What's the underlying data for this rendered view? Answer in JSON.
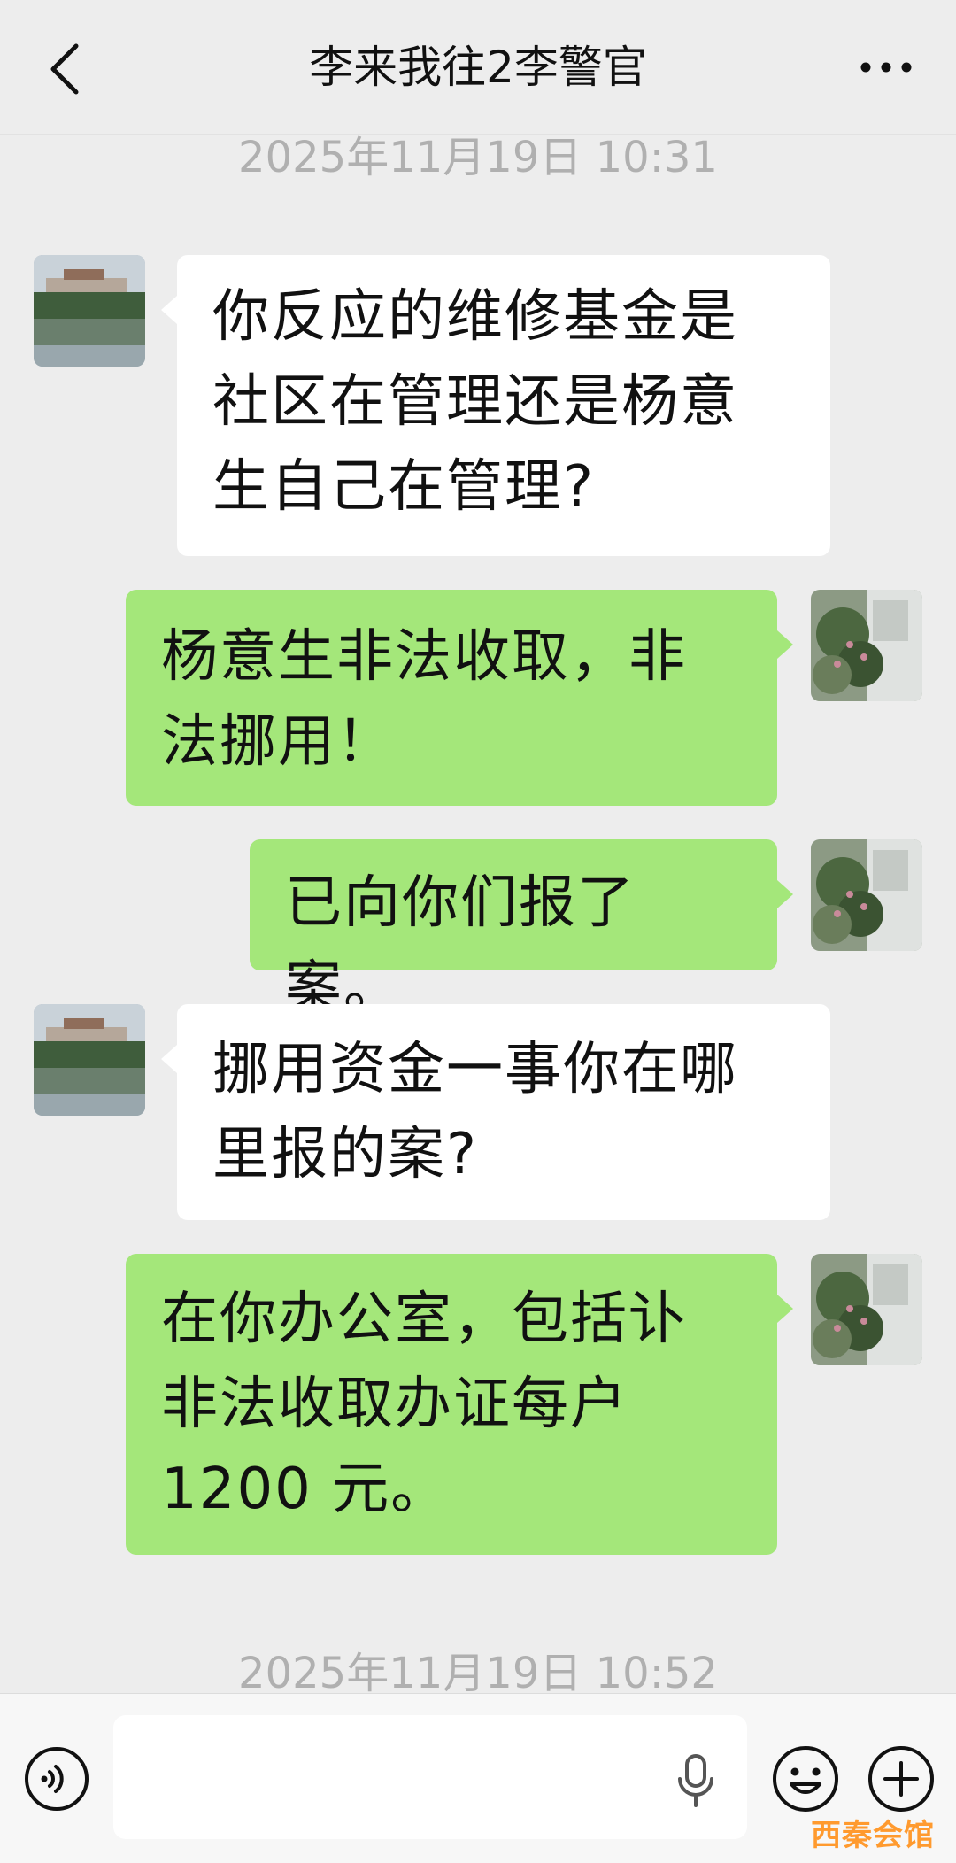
{
  "header": {
    "title": "李来我往2李警官",
    "back_icon": "chevron-left-icon",
    "more_icon": "more-horizontal-icon"
  },
  "timestamps": [
    "2025年11月19日 10:31",
    "2025年11月19日 10:52"
  ],
  "messages": [
    {
      "side": "in",
      "text": "你反应的维修基金是\n社区在管理还是杨意\n生自己在管理?"
    },
    {
      "side": "out",
      "text": "杨意生非法收取，非\n法挪用！"
    },
    {
      "side": "out",
      "text": "已向你们报了案。"
    },
    {
      "side": "in",
      "text": "挪用资金一事你在哪\n里报的案?"
    },
    {
      "side": "out",
      "text": "在你办公室，包括讣\n非法收取办证每户\n1200 元。"
    }
  ],
  "input_bar": {
    "value": "",
    "voice_icon": "voice-mode-icon",
    "mic_icon": "microphone-icon",
    "emoji_icon": "emoji-icon",
    "plus_icon": "plus-icon"
  },
  "watermark": "西秦会馆",
  "colors": {
    "background": "#ededed",
    "outgoing_bubble": "#a4e77a",
    "incoming_bubble": "#ffffff",
    "timestamp": "#b0b0b0",
    "watermark": "#ff9a2e"
  }
}
